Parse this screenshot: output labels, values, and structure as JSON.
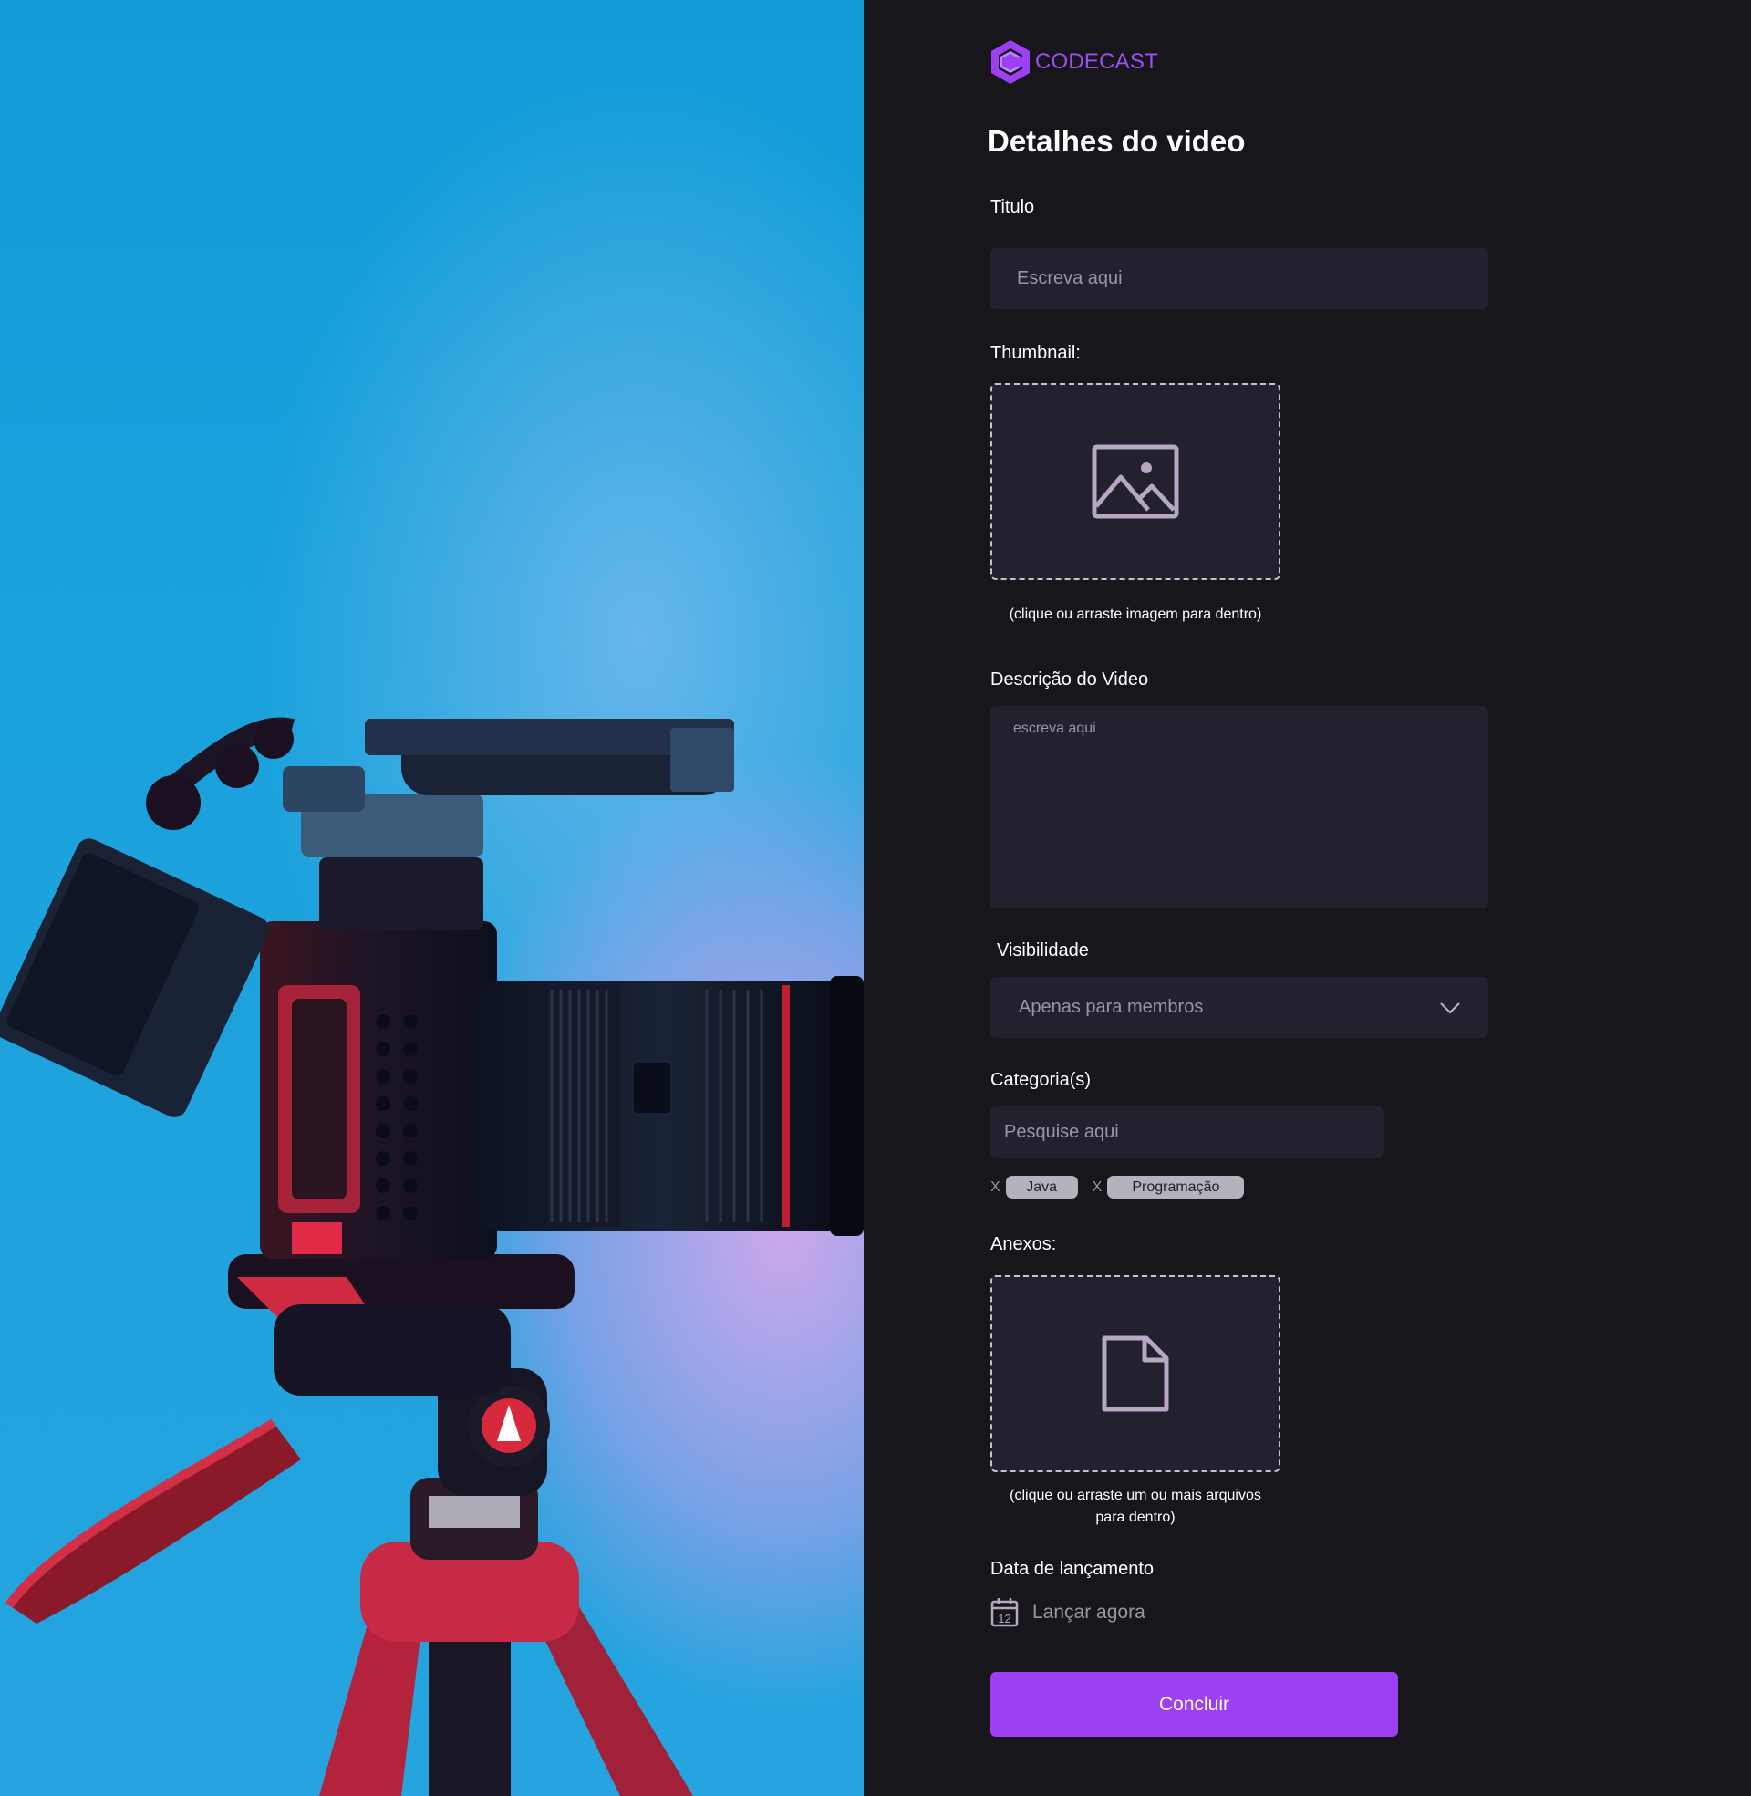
{
  "brand": {
    "name": "CODECAST",
    "accent": "#9d3ff2"
  },
  "page": {
    "title": "Detalhes do video"
  },
  "form": {
    "title_label": "Titulo",
    "title_placeholder": "Escreva aqui",
    "thumbnail_label": "Thumbnail:",
    "thumbnail_hint": "(clique ou arraste imagem para dentro)",
    "description_label": "Descrição do Video",
    "description_placeholder": "escreva aqui",
    "visibility_label": "Visibilidade",
    "visibility_value": "Apenas para membros",
    "category_label": "Categoria(s)",
    "category_placeholder": "Pesquise aqui",
    "tags": [
      {
        "remove": "X",
        "label": "Java"
      },
      {
        "remove": "X",
        "label": "Programação"
      }
    ],
    "attachments_label": "Anexos:",
    "attachments_hint_line1": "(clique ou arraste um ou mais arquivos",
    "attachments_hint_line2": "para dentro)",
    "release_label": "Data de lançamento",
    "release_value": "Lançar agora",
    "calendar_day": "12",
    "submit_label": "Concluir"
  },
  "icons": [
    "logo-icon",
    "image-icon",
    "chevron-down-icon",
    "file-icon",
    "calendar-icon"
  ]
}
